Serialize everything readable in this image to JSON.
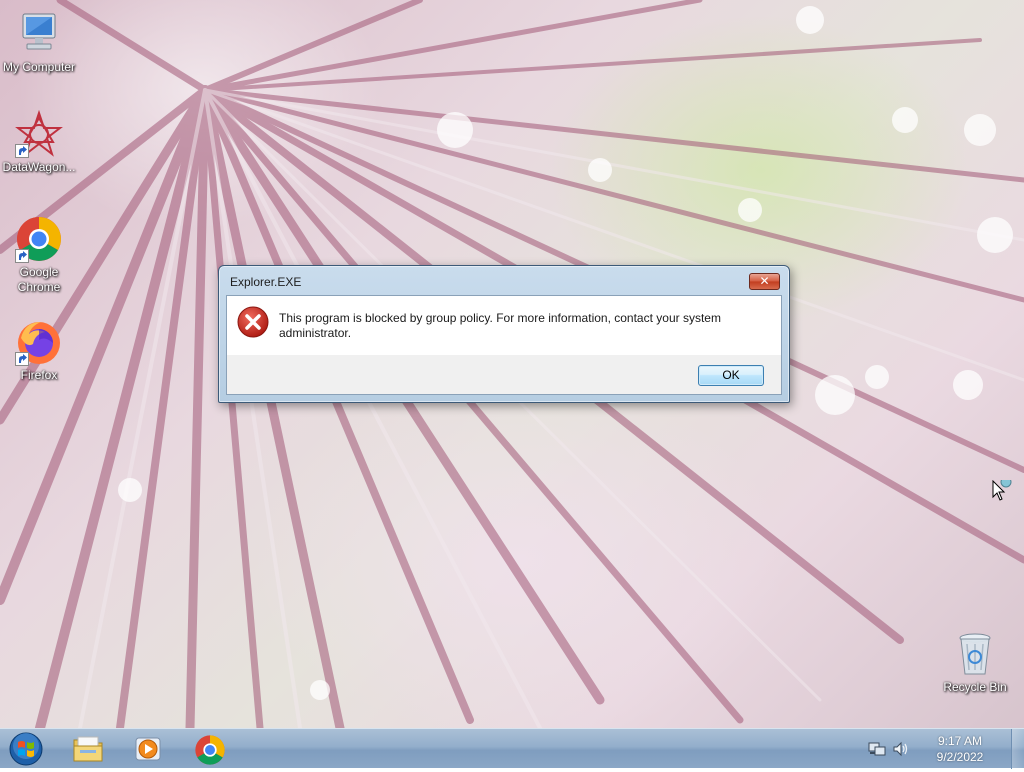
{
  "desktop": {
    "icons": [
      {
        "label": "My Computer",
        "icon": "computer-icon",
        "shortcut": false
      },
      {
        "label": "DataWagon...",
        "icon": "datawagon-icon",
        "shortcut": true
      },
      {
        "label": "Google Chrome",
        "icon": "chrome-icon",
        "shortcut": true
      },
      {
        "label": "Firefox",
        "icon": "firefox-icon",
        "shortcut": true
      },
      {
        "label": "Recycle Bin",
        "icon": "recycle-bin-icon",
        "shortcut": false
      }
    ]
  },
  "dialog": {
    "title": "Explorer.EXE",
    "close_label": "✕",
    "icon": "error-icon",
    "message": "This program is blocked by group policy. For more information, contact your system administrator.",
    "ok_label": "OK"
  },
  "taskbar": {
    "start_icon": "windows-start-icon",
    "pinned": [
      {
        "icon": "file-explorer-icon"
      },
      {
        "icon": "media-player-icon"
      },
      {
        "icon": "chrome-icon"
      }
    ],
    "tray": {
      "network_icon": "network-icon",
      "volume_icon": "volume-icon",
      "time": "9:17 AM",
      "date": "9/2/2022"
    }
  },
  "colors": {
    "dialog_frame": "#b5cde2",
    "close_button": "#c13d1f",
    "error_red": "#c8261a",
    "taskbar": "#8ba7c6"
  }
}
